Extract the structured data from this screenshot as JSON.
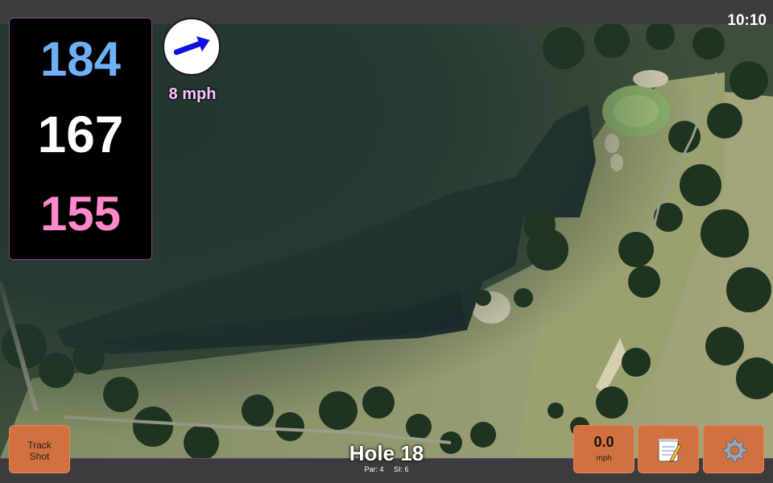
{
  "status_bar": {
    "clock": "10:10"
  },
  "distances": {
    "back": "184",
    "center": "167",
    "front": "155"
  },
  "wind": {
    "speed": "8 mph",
    "direction_deg": -20,
    "icon": "wind-arrow-icon"
  },
  "buttons": {
    "track_shot": {
      "line1": "Track",
      "line2": "Shot"
    },
    "speed": {
      "value": "0.0",
      "unit": "mph"
    },
    "notes_icon": "notepad-icon",
    "settings_icon": "gear-icon"
  },
  "hole": {
    "title": "Hole 18",
    "par": "Par: 4",
    "si": "SI: 6"
  },
  "colors": {
    "back_distance": "#6fb1f6",
    "center_distance": "#ffffff",
    "front_distance": "#ff89c9",
    "accent_border": "#8a4a96",
    "button_orange": "#d2703f",
    "wind_text": "#ffc4ff"
  }
}
